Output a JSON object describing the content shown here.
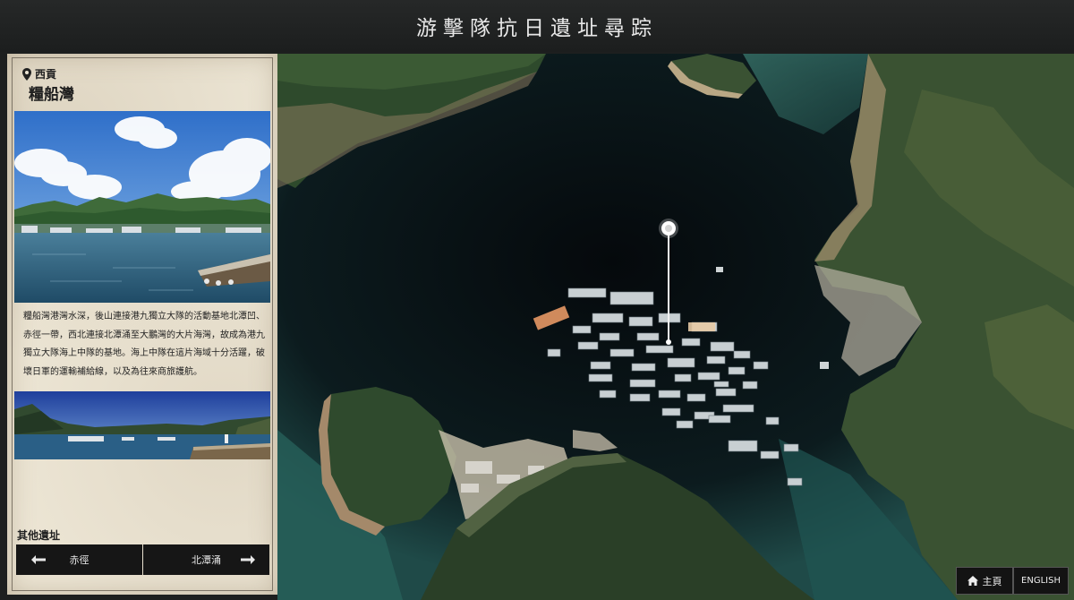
{
  "header": {
    "title": "游擊隊抗日遺址尋踪"
  },
  "site": {
    "region": "西貢",
    "name": "糧船灣",
    "description": "糧船灣港灣水深，後山連接港九獨立大隊的活動基地北潭凹、赤徑一帶，西北連接北潭涌至大鵬灣的大片海灣，故成為港九獨立大隊海上中隊的基地。海上中隊在這片海域十分活躍，破壞日軍的運輸補給線，以及為往來商旅護航。",
    "photo_main_alt": "糧船灣碼頭照片",
    "photo_pano_alt": "糧船灣全景照片"
  },
  "other_sites": {
    "label": "其他遺址",
    "prev": "赤徑",
    "next": "北潭涌"
  },
  "map": {
    "marker_icon": "location-marker-icon"
  },
  "footer": {
    "home_label": "主頁",
    "lang_label": "ENGLISH"
  },
  "colors": {
    "panel_bg": "#ece5d4",
    "button_bg": "#161616",
    "header_bg": "#1f2121"
  }
}
